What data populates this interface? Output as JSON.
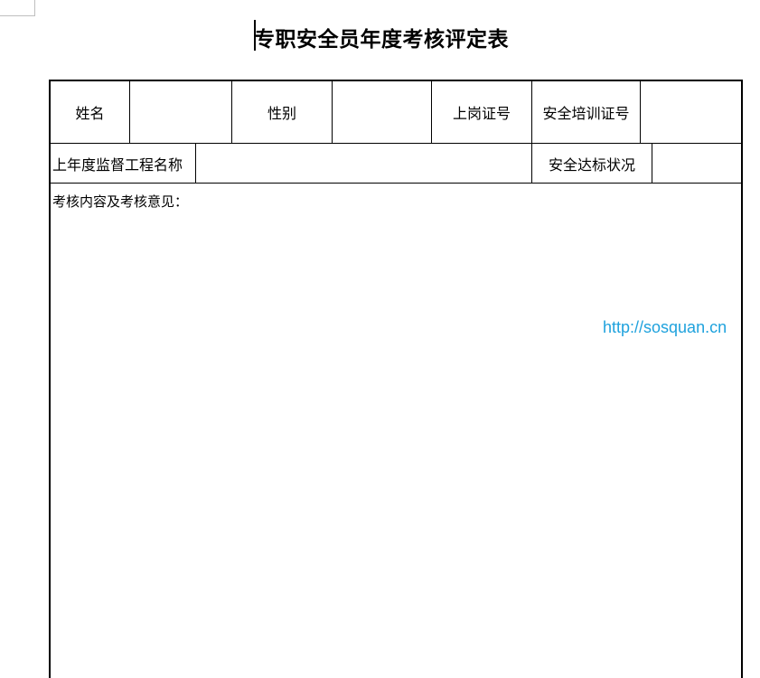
{
  "document": {
    "title": "专职安全员年度考核评定表",
    "watermark": "http://sosquan.cn"
  },
  "form": {
    "row1": {
      "name_label": "姓名",
      "name_value": "",
      "gender_label": "性别",
      "gender_value": "",
      "post_cert_label": "上岗证号",
      "post_cert_value": "",
      "training_cert_label": "安全培训证号",
      "training_cert_value": ""
    },
    "row2": {
      "project_label": "上年度监督工程名称",
      "project_value": "",
      "standard_label": "安全达标状况",
      "standard_value": ""
    },
    "assessment_label": "考核内容及考核意见："
  }
}
